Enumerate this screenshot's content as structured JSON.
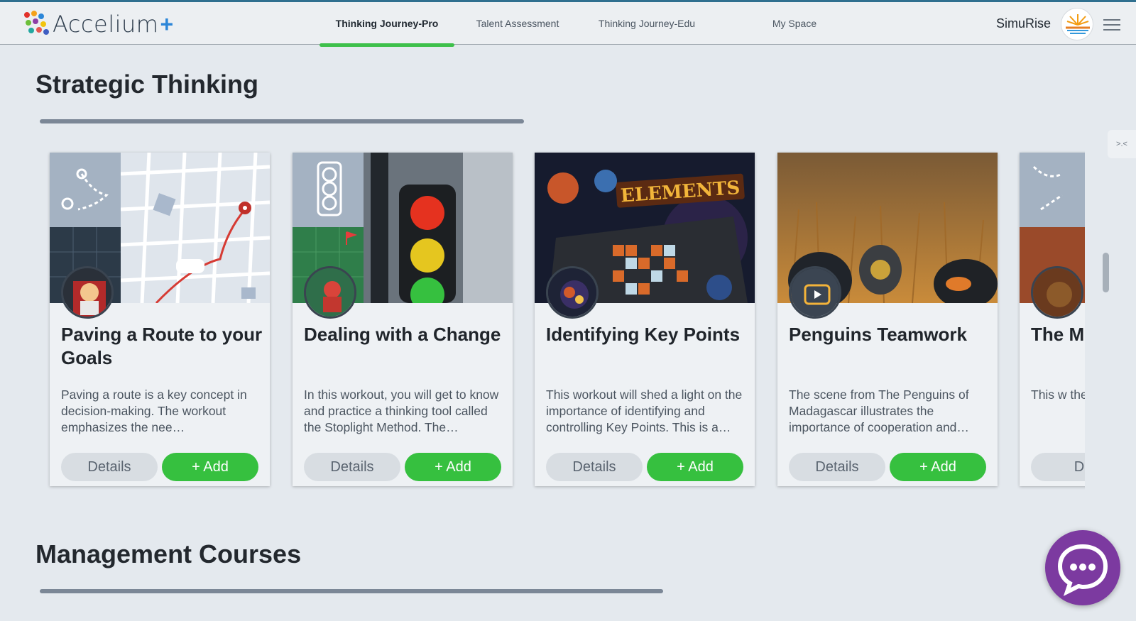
{
  "header": {
    "logo_text": "Accelium",
    "logo_plus": "+",
    "tabs": [
      {
        "label": "Thinking Journey-Pro",
        "active": true
      },
      {
        "label": "Talent Assessment",
        "active": false
      },
      {
        "label": "Thinking Journey-Edu",
        "active": false
      },
      {
        "label": "My Space",
        "active": false
      }
    ],
    "user_name": "SimuRise"
  },
  "sections": [
    {
      "title": "Strategic Thinking"
    },
    {
      "title": "Management Courses"
    }
  ],
  "cards": [
    {
      "title": "Paving a Route to your Goals",
      "description": "Paving a route is a key concept in decision-making. The workout emphasizes the nee…",
      "details_label": "Details",
      "add_label": "+ Add"
    },
    {
      "title": "Dealing with a Change",
      "description": "In this workout, you will get to know and practice a thinking tool called the Stoplight Method. The…",
      "details_label": "Details",
      "add_label": "+ Add"
    },
    {
      "title": "Identifying Key Points",
      "description": "This workout will shed a light on the importance of identifying and controlling Key Points. This is a…",
      "details_label": "Details",
      "add_label": "+ Add",
      "image_text": "ELEMENTS"
    },
    {
      "title": "Penguins Teamwork",
      "description": "The scene from The Penguins of Madagascar illustrates the importance of cooperation and…",
      "details_label": "Details",
      "add_label": "+ Add"
    },
    {
      "title": "The Met",
      "description": "This w the co of mig",
      "details_label": "D",
      "add_label": ""
    }
  ],
  "side_tab_glyph": ">.<",
  "colors": {
    "accent_green": "#36c03f",
    "chat_purple": "#7c3aa0",
    "brand_blue": "#2c86d8"
  }
}
